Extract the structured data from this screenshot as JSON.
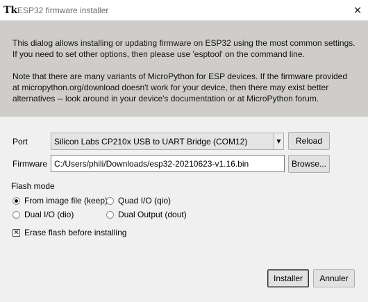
{
  "window": {
    "title": "ESP32 firmware installer",
    "app_icon": "Tk",
    "close_glyph": "✕"
  },
  "info": {
    "paragraph1": "This dialog allows installing or updating firmware on ESP32 using the most common settings. If you need to set other options, then please use 'esptool' on the command line.",
    "paragraph2": "Note that there are many variants of MicroPython for ESP devices. If the firmware provided at micropython.org/download doesn't work for your device, then there may exist better alternatives -- look around in your device's documentation or at MicroPython forum."
  },
  "port": {
    "label": "Port",
    "selected": "Silicon Labs CP210x USB to UART Bridge (COM12)",
    "reload_label": "Reload"
  },
  "firmware": {
    "label": "Firmware",
    "value": "C:/Users/phili/Downloads/esp32-20210623-v1.16.bin",
    "browse_label": "Browse..."
  },
  "flash_mode": {
    "label": "Flash mode",
    "options": [
      {
        "label": "From image file (keep)",
        "selected": true
      },
      {
        "label": "Quad I/O (qio)",
        "selected": false
      },
      {
        "label": "Dual I/O (dio)",
        "selected": false
      },
      {
        "label": "Dual Output (dout)",
        "selected": false
      }
    ]
  },
  "erase": {
    "label": "Erase flash before installing",
    "checked": true,
    "check_glyph": "✕"
  },
  "buttons": {
    "install_label": "Installer",
    "cancel_label": "Annuler"
  }
}
